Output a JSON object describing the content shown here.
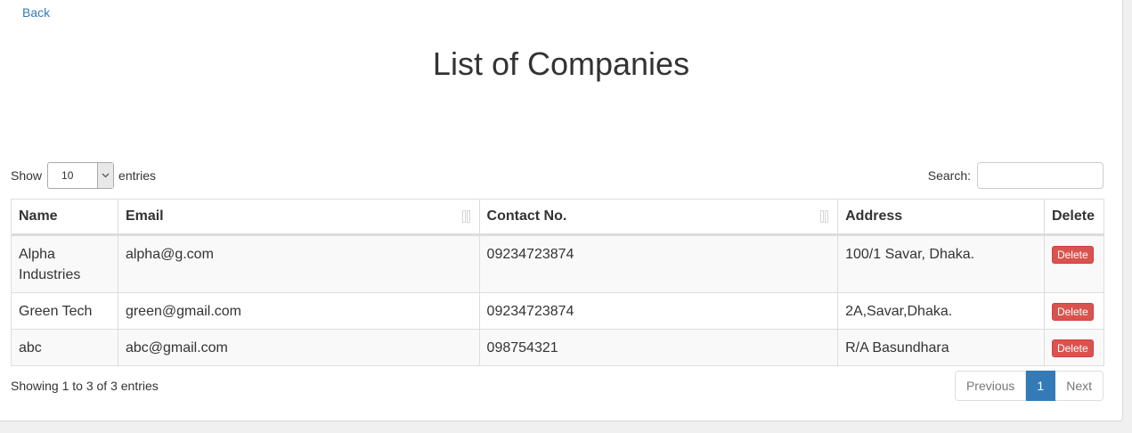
{
  "nav": {
    "back_label": "Back"
  },
  "page": {
    "title": "List of Companies"
  },
  "controls": {
    "show_label": "Show",
    "length_value": "10",
    "entries_label": "entries",
    "search_label": "Search:",
    "search_value": ""
  },
  "table": {
    "headers": [
      "Name",
      "Email",
      "Contact No.",
      "Address",
      "Delete"
    ],
    "rows": [
      {
        "name": "Alpha Industries",
        "email": "alpha@g.com",
        "contact": "09234723874",
        "address": "100/1 Savar, Dhaka.",
        "delete_label": "Delete"
      },
      {
        "name": "Green Tech",
        "email": "green@gmail.com",
        "contact": "09234723874",
        "address": "2A,Savar,Dhaka.",
        "delete_label": "Delete"
      },
      {
        "name": "abc",
        "email": "abc@gmail.com",
        "contact": "098754321",
        "address": "R/A Basundhara",
        "delete_label": "Delete"
      }
    ]
  },
  "footer": {
    "info": "Showing 1 to 3 of 3 entries",
    "previous_label": "Previous",
    "current_page": "1",
    "next_label": "Next"
  },
  "colors": {
    "link": "#337ab7",
    "danger": "#d9534f",
    "primary": "#337ab7"
  }
}
